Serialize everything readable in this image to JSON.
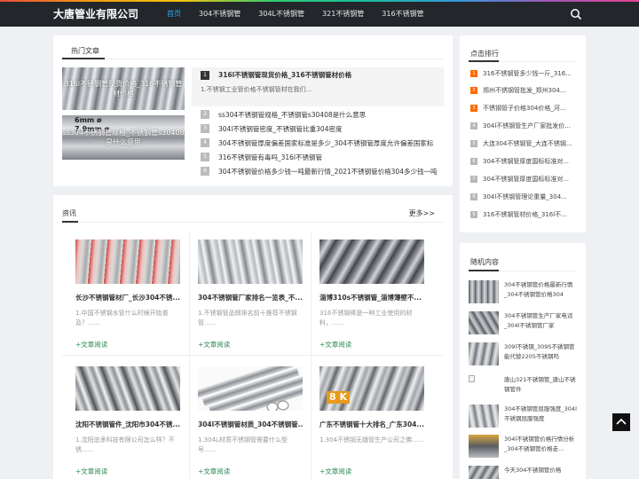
{
  "site": {
    "title": "大唐管业有限公司"
  },
  "nav": [
    {
      "label": "首页",
      "active": true
    },
    {
      "label": "304不锈钢管"
    },
    {
      "label": "304L不锈钢管"
    },
    {
      "label": "321不锈钢管"
    },
    {
      "label": "316不锈钢管"
    }
  ],
  "hot": {
    "tab_label": "热门文章",
    "thumb1_caption": "316l不锈钢管现货价格_316不锈钢管材价格",
    "thumb2_overlay": "6mm ø 7.9mm ø",
    "thumb2_caption": "ss304不锈钢管规格_不锈钢管s30408是什么意思",
    "first": {
      "num": "1",
      "title": "316l不锈钢管现货价格_316不锈钢管材价格",
      "desc": "1.不锈钢工业管价格不锈钢管材在我们..."
    },
    "items": [
      {
        "num": "2",
        "title": "ss304不锈钢管规格_不锈钢管s30408是什么意思"
      },
      {
        "num": "3",
        "title": "304l不锈钢管密度_不锈钢管比重304密度"
      },
      {
        "num": "4",
        "title": "304不锈钢管厚度偏差国家标准是多少_304不锈钢管厚度允许偏差国家标"
      },
      {
        "num": "5",
        "title": "316不锈钢管有毒吗_316l不锈钢管"
      },
      {
        "num": "6",
        "title": "304不锈钢管价格多少钱一吨最新行情_2021不锈钢管价格304多少钱一吨"
      }
    ]
  },
  "news": {
    "tab_label": "资讯",
    "more_label": "更多>>",
    "items": [
      {
        "title": "长沙不锈钢管材厂_长沙304不锈...",
        "desc": "1.中国不锈钢水管什么时候开始普及？......",
        "more": "+文章阅读",
        "img": "red"
      },
      {
        "title": "304不锈钢管厂家排名一览表_不...",
        "desc": "1.不锈钢管品牌排名前十推荐不锈钢管......",
        "more": "+文章阅读",
        "img": "silver"
      },
      {
        "title": "淄博310s不锈钢管_淄博薄壁不...",
        "desc": "316不锈钢棒是一种工业使用的材料，......",
        "more": "+文章阅读",
        "img": "dark"
      },
      {
        "title": "沈阳不锈钢管件_沈阳市304不锈...",
        "desc": "1.沈阳忠承科技有限公司怎么样？不锈......",
        "more": "+文章阅读",
        "img": "shiny"
      },
      {
        "title": "304l不锈钢管材质_304不锈钢管...",
        "desc": "1.304L材质不锈钢管需要什么型号......",
        "more": "+文章阅读",
        "img": "tubes"
      },
      {
        "title": "广东不锈钢管十大排名_广东304...",
        "desc": "1.304不锈钢无缝管生产公司之佛......",
        "more": "+文章阅读",
        "img": "8k",
        "overlay": "8 K"
      }
    ]
  },
  "rank": {
    "tab_label": "点击排行",
    "items": [
      {
        "num": "1",
        "text": "316不锈钢管多少钱一斤_316..."
      },
      {
        "num": "2",
        "text": "郑州不锈钢管批发_郑州304..."
      },
      {
        "num": "3",
        "text": "不锈钢管子价格304价格_河..."
      },
      {
        "num": "4",
        "text": "304l不锈钢管生产厂家批发价..."
      },
      {
        "num": "5",
        "text": "大连304不锈钢管_大连不锈钢..."
      },
      {
        "num": "6",
        "text": "304不锈钢管厚度国标标准对..."
      },
      {
        "num": "7",
        "text": "304不锈钢管厚度国标标准对..."
      },
      {
        "num": "8",
        "text": "304l不锈钢管理论重量_304..."
      },
      {
        "num": "9",
        "text": "316不锈钢管材价格_316l不..."
      }
    ]
  },
  "random": {
    "tab_label": "随机内容",
    "items": [
      {
        "text": "304不锈钢管价格最新行情_304不锈钢管价格304",
        "img": "pipe1"
      },
      {
        "text": "304不锈钢管生产厂家电话_304l不锈钢管厂家",
        "img": "pipe2"
      },
      {
        "text": "309l不锈钢_309S不锈钢管能代替2205不锈钢吗",
        "img": "pipe3"
      },
      {
        "text": "唐山321不锈钢管_唐山不锈钢管件",
        "img": "broken"
      },
      {
        "text": "304不锈钢管屈服强度_304l不锈钢屈服强度",
        "img": "pipe4"
      },
      {
        "text": "304l不锈钢管价格行情分析_304不锈钢管价格走...",
        "img": "pipe5"
      },
      {
        "text": "今天304不锈钢管价格",
        "img": "pipe6"
      }
    ]
  },
  "colors": {
    "accent": "#2aa7e8",
    "rank_hot": "#ff6a00",
    "rank_normal": "#b8b8b8",
    "more_green": "#2e8b57"
  }
}
